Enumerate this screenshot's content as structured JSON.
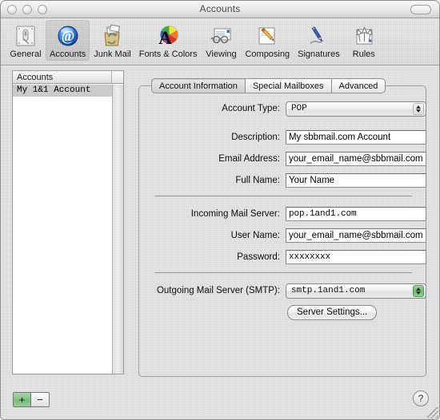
{
  "window": {
    "title": "Accounts",
    "controls": {
      "close": "close-button",
      "minimize": "minimize-button",
      "zoom": "zoom-button",
      "toolbar_toggle": "toolbar-toggle-button"
    }
  },
  "toolbar": {
    "items": [
      {
        "label": "General",
        "icon": "general-icon",
        "selected": false
      },
      {
        "label": "Accounts",
        "icon": "accounts-at-icon",
        "selected": true
      },
      {
        "label": "Junk Mail",
        "icon": "junk-mail-icon",
        "selected": false
      },
      {
        "label": "Fonts & Colors",
        "icon": "fonts-colors-icon",
        "selected": false
      },
      {
        "label": "Viewing",
        "icon": "viewing-icon",
        "selected": false
      },
      {
        "label": "Composing",
        "icon": "composing-icon",
        "selected": false
      },
      {
        "label": "Signatures",
        "icon": "signatures-icon",
        "selected": false
      },
      {
        "label": "Rules",
        "icon": "rules-icon",
        "selected": false
      }
    ]
  },
  "accounts_list": {
    "header": "Accounts",
    "rows": [
      {
        "name": "My 1&1 Account",
        "selected": true
      }
    ],
    "add_label": "+",
    "remove_label": "−"
  },
  "tabs": [
    {
      "label": "Account Information",
      "selected": true
    },
    {
      "label": "Special Mailboxes",
      "selected": false
    },
    {
      "label": "Advanced",
      "selected": false
    }
  ],
  "account_information": {
    "account_type": {
      "label": "Account Type:",
      "value": "POP",
      "arrows_color": "#2c2c2c",
      "arrows_background": "#dedede"
    },
    "description": {
      "label": "Description:",
      "value": "My sbbmail.com Account"
    },
    "email_address": {
      "label": "Email Address:",
      "value": "your_email_name@sbbmail.com"
    },
    "full_name": {
      "label": "Full Name:",
      "value": "Your Name"
    },
    "incoming_mail_server": {
      "label": "Incoming Mail Server:",
      "value": "pop.1and1.com"
    },
    "user_name": {
      "label": "User Name:",
      "value": "your_email_name@sbbmail.com"
    },
    "password": {
      "label": "Password:",
      "value": "xxxxxxxx"
    },
    "outgoing_mail_server": {
      "label": "Outgoing Mail Server (SMTP):",
      "value": "smtp.1and1.com",
      "arrows_background": "#7cbd7e"
    },
    "server_settings_button": "Server Settings..."
  },
  "help": {
    "label": "?"
  }
}
